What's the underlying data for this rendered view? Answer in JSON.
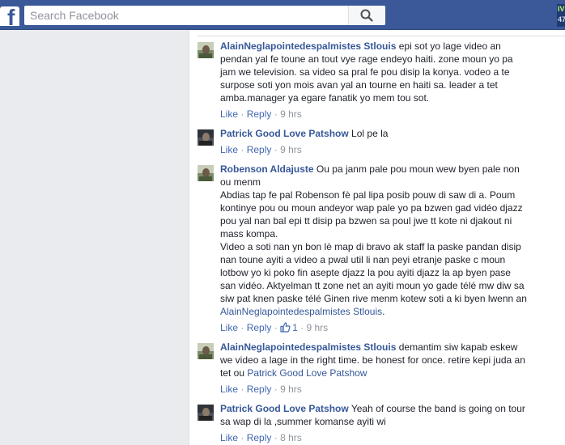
{
  "topbar": {
    "logo": "f",
    "search_placeholder": "Search Facebook",
    "search_icon": "magnifier-icon",
    "corner_line1": "IV",
    "corner_line2": "47"
  },
  "actions": {
    "like": "Like",
    "reply": "Reply",
    "separator": "·"
  },
  "comments": [
    {
      "author": "AlainNeglapointedespalmistes Stlouis",
      "text_lines": [
        "epi sot yo lage video an",
        "pendan yal fe toune an tout vye rage endeyo haiti. zone moun yo pa",
        "jam we television. sa video sa pral fe pou disip la konya. vodeo a te",
        "surpose soti yon mois avan yal an tourne en haiti sa. leader a tet",
        "amba.manager ya egare fanatik yo mem tou sot."
      ],
      "time": "9 hrs"
    },
    {
      "author": "Patrick Good Love Patshow",
      "text_lines": [
        "Lol pe la"
      ],
      "time": "9 hrs"
    },
    {
      "author": "Robenson Aldajuste",
      "text_lines": [
        "Ou pa janm pale pou moun wew byen pale non",
        "ou menm",
        "Abdias tap fe pal Robenson fè pal lipa posib pouw di saw di a. Poum",
        "kontinye pou ou moun andeyor wap pale yo pa bzwen gad vidéo djazz",
        "pou yal nan bal epi tt disip pa bzwen sa poul jwe tt kote ni djakout ni",
        "mass kompa.",
        "Video a soti nan yn bon lè map di bravo ak staff la paske pandan disip",
        "nan toune ayiti a video a pwal util li nan peyi etranje paske c moun",
        "lotbow yo ki poko fin asepte djazz la pou ayiti djazz la ap byen pase",
        "san vidéo. Aktyelman tt zone net an ayiti moun yo gade télé mw diw sa",
        "siw pat knen paske télé Ginen rive menm kotew soti a ki byen lwenn an"
      ],
      "mention": "AlainNeglapointedespalmistes Stlouis",
      "mention_suffix": ".",
      "likes": "1",
      "time": "9 hrs"
    },
    {
      "author": "AlainNeglapointedespalmistes Stlouis",
      "text_lines": [
        "demantim siw kapab eskew",
        "we video a lage in the right time. be honest for once. retire kepi juda an",
        "tet ou"
      ],
      "mention": "Patrick Good Love Patshow",
      "time": "9 hrs"
    },
    {
      "author": "Patrick Good Love Patshow",
      "text_lines": [
        "Yeah of course the band is going on tour",
        "sa wap di la ,summer komanse ayiti wi"
      ],
      "time": "8 hrs"
    }
  ]
}
